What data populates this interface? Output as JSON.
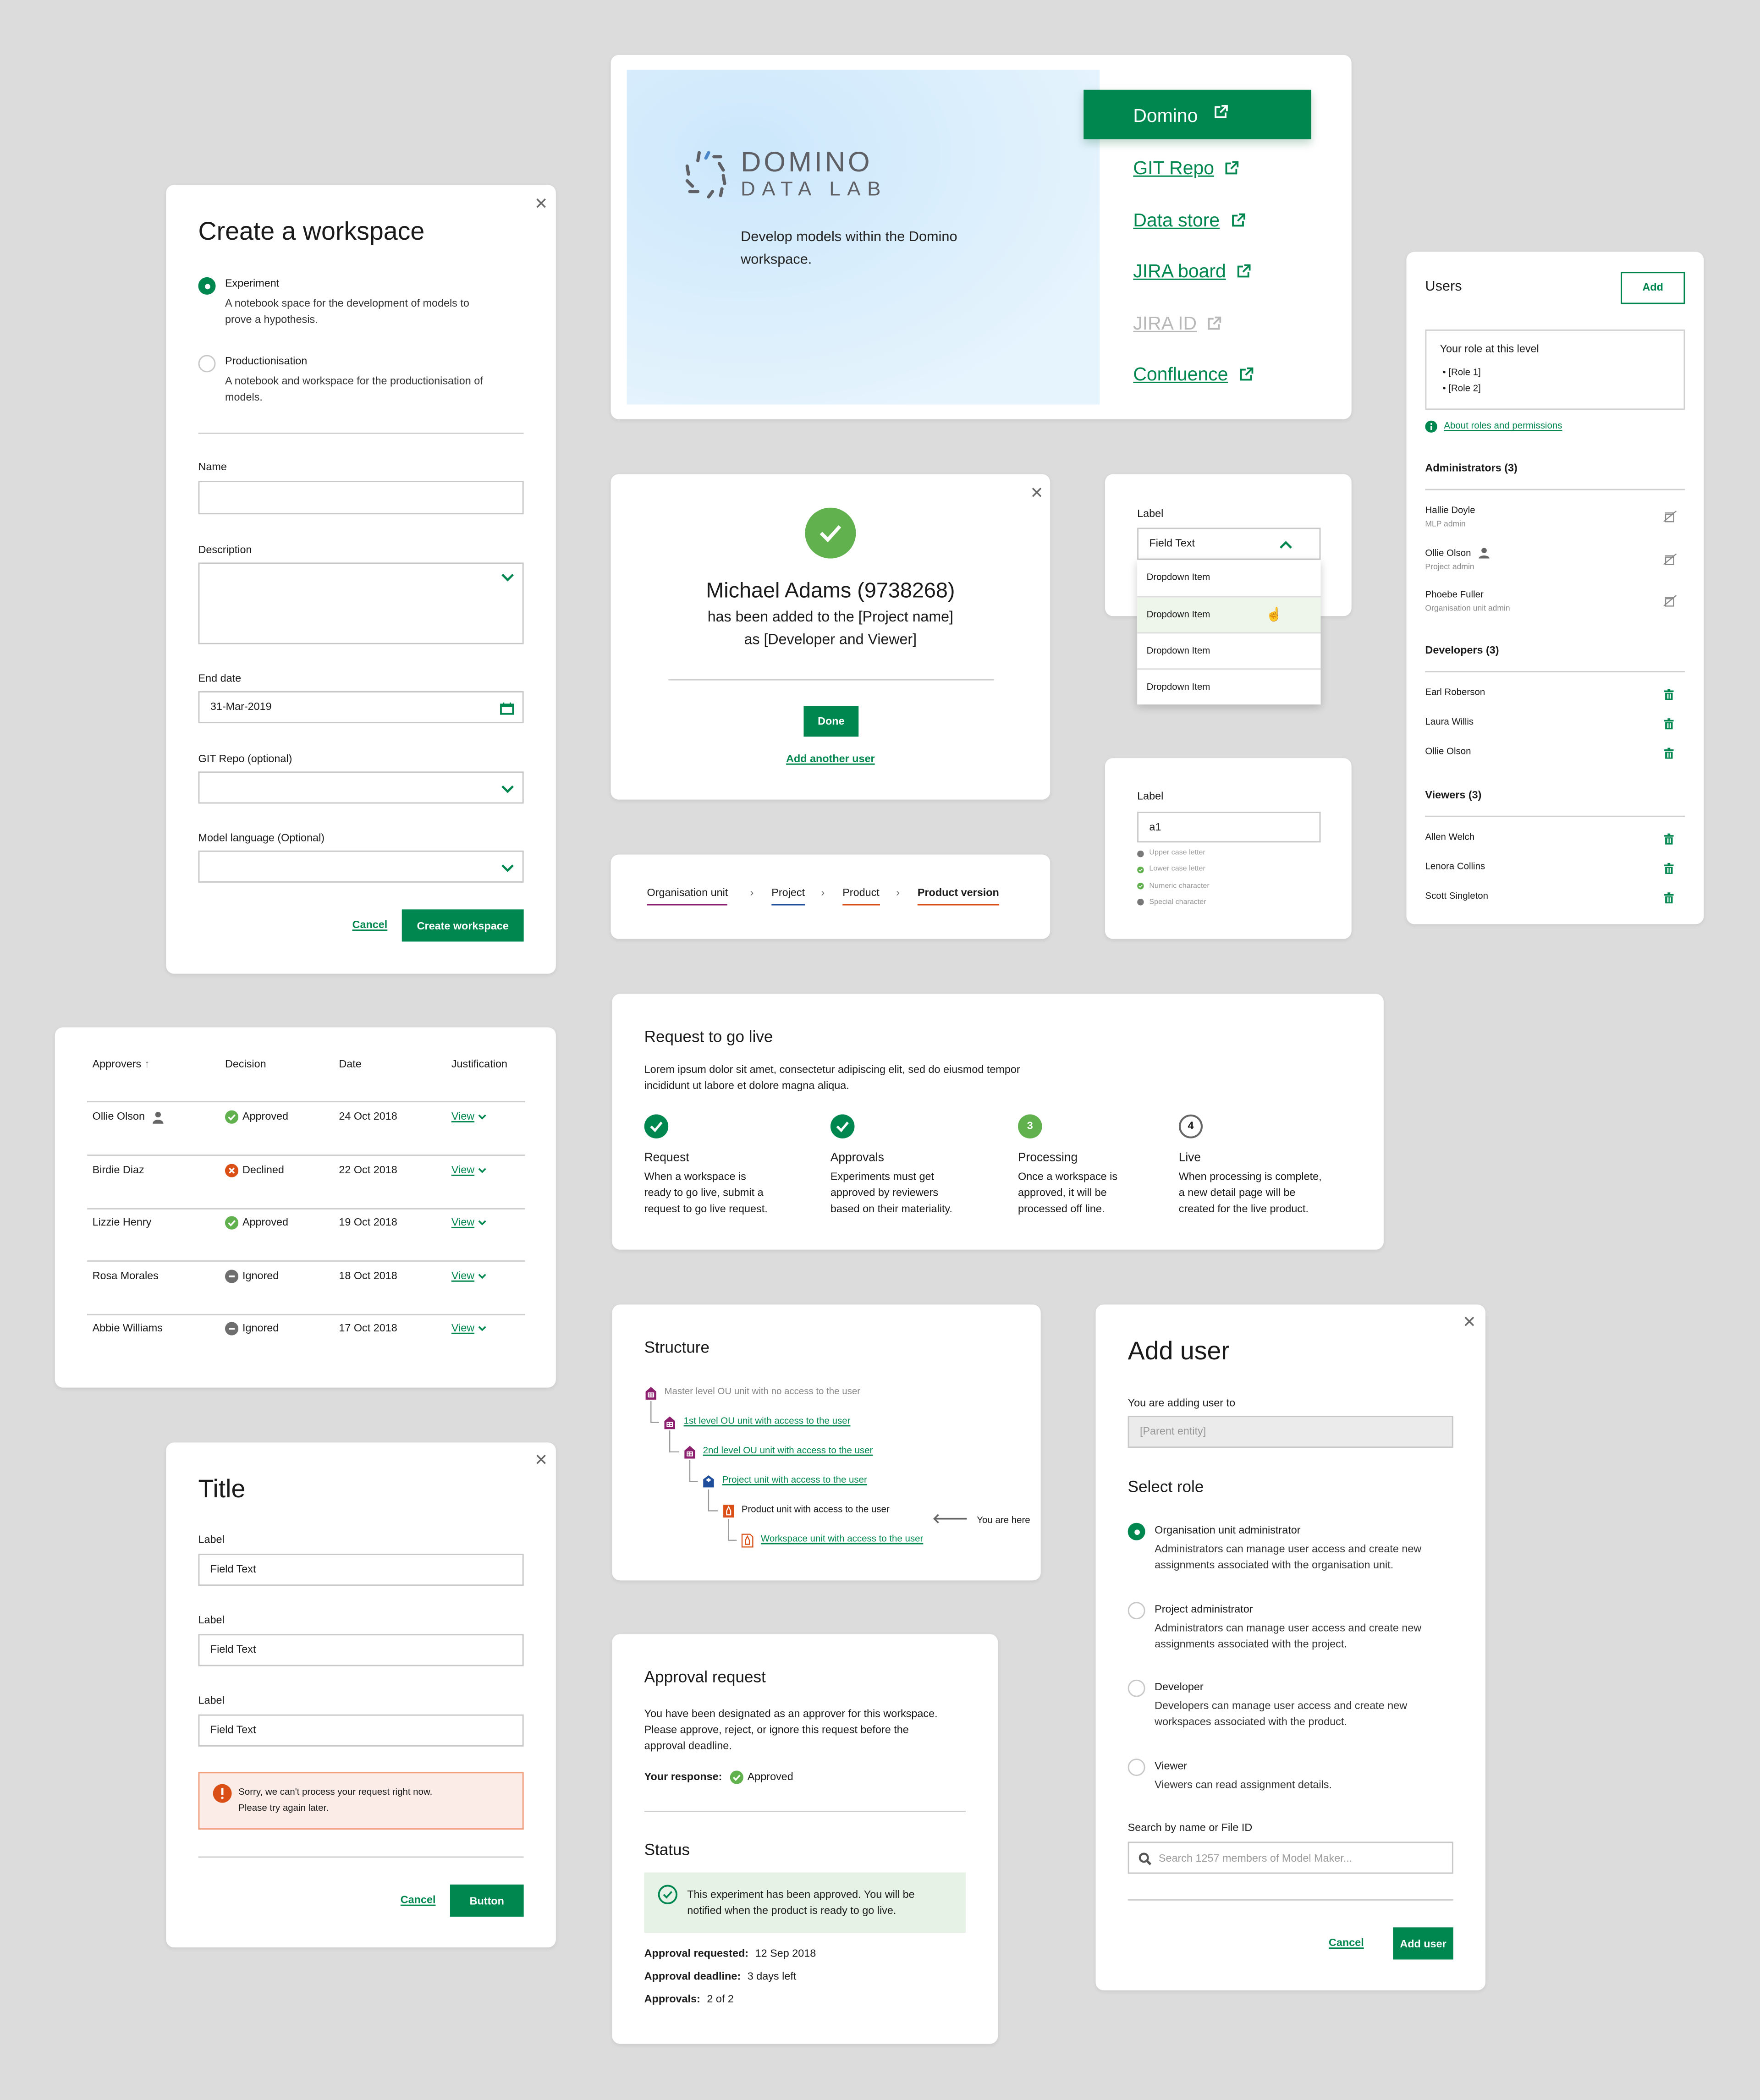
{
  "colors": {
    "primary": "#00874f",
    "success": "#62b14f",
    "error": "#d94f16",
    "ou": "#8b1f6e",
    "project": "#1f4e9c",
    "product": "#d94f16"
  },
  "create_workspace": {
    "title": "Create a workspace",
    "types": [
      {
        "label": "Experiment",
        "desc1": "A notebook space for the development of models to",
        "desc2": "prove a hypothesis.",
        "selected": true
      },
      {
        "label": "Productionisation",
        "desc1": "A notebook and workspace for the productionisation of",
        "desc2": "models.",
        "selected": false
      }
    ],
    "name_label": "Name",
    "name_value": "",
    "description_label": "Description",
    "end_date_label": "End date",
    "end_date_value": "31-Mar-2019",
    "git_label": "GIT Repo (optional)",
    "language_label": "Model language (Optional)",
    "cancel": "Cancel",
    "submit": "Create workspace"
  },
  "domino": {
    "logo_top": "DOMINO",
    "logo_bottom": "DATA LAB",
    "description1": "Develop models within the Domino",
    "description2": "workspace.",
    "primary_link": "Domino",
    "links": [
      {
        "label": "GIT Repo",
        "disabled": false
      },
      {
        "label": "Data store",
        "disabled": false
      },
      {
        "label": "JIRA board",
        "disabled": false
      },
      {
        "label": "JIRA ID",
        "disabled": true
      },
      {
        "label": "Confluence",
        "disabled": false
      }
    ]
  },
  "users": {
    "title": "Users",
    "add": "Add",
    "role_title": "Your role at this level",
    "roles": [
      "[Role 1]",
      "[Role 2]"
    ],
    "about_link": "About roles and permissions",
    "groups": [
      {
        "title": "Administrators (3)",
        "members": [
          {
            "name": "Hallie Doyle",
            "role": "MLP admin",
            "current": false,
            "removable": false
          },
          {
            "name": "Ollie Olson",
            "role": "Project admin",
            "current": true,
            "removable": false
          },
          {
            "name": "Phoebe Fuller",
            "role": "Organisation unit admin",
            "current": false,
            "removable": false
          }
        ]
      },
      {
        "title": "Developers (3)",
        "members": [
          {
            "name": "Earl Roberson",
            "removable": true
          },
          {
            "name": "Laura Willis",
            "removable": true
          },
          {
            "name": "Ollie Olson",
            "removable": true
          }
        ]
      },
      {
        "title": "Viewers (3)",
        "members": [
          {
            "name": "Allen Welch",
            "removable": true
          },
          {
            "name": "Lenora Collins",
            "removable": true
          },
          {
            "name": "Scott Singleton",
            "removable": true
          }
        ]
      }
    ]
  },
  "success": {
    "name": "Michael Adams (9738268)",
    "line2": "has been added to the [Project name]",
    "line3": "as [Developer and Viewer]",
    "done": "Done",
    "add_another": "Add another user"
  },
  "dropdown": {
    "label": "Label",
    "value": "Field Text",
    "items": [
      "Dropdown Item",
      "Dropdown Item",
      "Dropdown Item",
      "Dropdown Item"
    ],
    "hovered_index": 1
  },
  "password": {
    "label": "Label",
    "value": "a1",
    "criteria": [
      {
        "text": "Upper case letter",
        "met": false
      },
      {
        "text": "Lower case letter",
        "met": true
      },
      {
        "text": "Numeric character",
        "met": true
      },
      {
        "text": "Special character",
        "met": false
      }
    ]
  },
  "breadcrumb": [
    {
      "label": "Organisation unit",
      "color": "#8b1f6e"
    },
    {
      "label": "Project",
      "color": "#1f4e9c"
    },
    {
      "label": "Product",
      "color": "#d94f16"
    },
    {
      "label": "Product version",
      "color": "#d94f16"
    }
  ],
  "approvers": {
    "headers": [
      "Approvers",
      "Decision",
      "Date",
      "Justification"
    ],
    "rows": [
      {
        "name": "Ollie Olson",
        "current": true,
        "decision": "Approved",
        "date": "24 Oct 2018",
        "link": "View"
      },
      {
        "name": "Birdie Diaz",
        "current": false,
        "decision": "Declined",
        "date": "22 Oct 2018",
        "link": "View"
      },
      {
        "name": "Lizzie Henry",
        "current": false,
        "decision": "Approved",
        "date": "19 Oct 2018",
        "link": "View"
      },
      {
        "name": "Rosa Morales",
        "current": false,
        "decision": "Ignored",
        "date": "18 Oct 2018",
        "link": "View"
      },
      {
        "name": "Abbie Williams",
        "current": false,
        "decision": "Ignored",
        "date": "17 Oct 2018",
        "link": "View"
      }
    ]
  },
  "go_live": {
    "title": "Request to go live",
    "intro1": "Lorem ipsum dolor sit amet, consectetur adipiscing elit, sed do eiusmod tempor",
    "intro2": "incididunt ut labore et dolore magna aliqua.",
    "steps": [
      {
        "marker": "",
        "state": "done",
        "title": "Request",
        "lines": [
          "When a workspace is",
          "ready to go live, submit a",
          "request to go live request."
        ]
      },
      {
        "marker": "",
        "state": "done",
        "title": "Approvals",
        "lines": [
          "Experiments must get",
          "approved by reviewers",
          "based on their materiality."
        ]
      },
      {
        "marker": "3",
        "state": "current",
        "title": "Processing",
        "lines": [
          "Once a workspace is",
          "approved, it will be",
          "processed off line."
        ]
      },
      {
        "marker": "4",
        "state": "todo",
        "title": "Live",
        "lines": [
          "When processing is complete,",
          "a new detail page will be",
          "created for the live product."
        ]
      }
    ]
  },
  "title_form": {
    "title": "Title",
    "fields": [
      {
        "label": "Label",
        "value": "Field Text"
      },
      {
        "label": "Label",
        "value": "Field Text"
      },
      {
        "label": "Label",
        "value": "Field Text"
      }
    ],
    "error1": "Sorry, we can't process your request right now.",
    "error2": "Please try again later.",
    "cancel": "Cancel",
    "submit": "Button"
  },
  "structure": {
    "title": "Structure",
    "nodes": [
      {
        "label": "Master level OU unit with no access to the user",
        "type": "ou",
        "link": false
      },
      {
        "label": "1st level OU unit with access to the user",
        "type": "ou",
        "link": true
      },
      {
        "label": "2nd level OU unit with access to the user",
        "type": "ou",
        "link": true
      },
      {
        "label": "Project unit with access to the user",
        "type": "project",
        "link": true
      },
      {
        "label": "Product unit with access to the user",
        "type": "product",
        "link": false
      },
      {
        "label": "Workspace unit with access to the user",
        "type": "workspace",
        "link": true
      }
    ],
    "you_are_here": "You are here"
  },
  "approval": {
    "title": "Approval request",
    "para": [
      "You have been designated as an approver for this workspace.",
      "Please approve, reject, or ignore this request before the",
      "approval deadline."
    ],
    "response_label": "Your response:",
    "response_value": "Approved",
    "status_title": "Status",
    "status1": "This experiment has been approved. You will be",
    "status2": "notified when the product is ready to go live.",
    "meta": [
      {
        "label": "Approval requested:",
        "value": "12 Sep 2018"
      },
      {
        "label": "Approval deadline:",
        "value": "3 days left"
      },
      {
        "label": "Approvals:",
        "value": "2 of 2"
      }
    ]
  },
  "add_user": {
    "title": "Add user",
    "target_label": "You are adding user to",
    "target_placeholder": "[Parent entity]",
    "role_title": "Select role",
    "roles": [
      {
        "label": "Organisation unit administrator",
        "d1": "Administrators can manage user access and create new",
        "d2": "assignments associated with the organisation unit.",
        "selected": true
      },
      {
        "label": "Project administrator",
        "d1": "Administrators can manage user access and create new",
        "d2": "assignments associated with the project.",
        "selected": false
      },
      {
        "label": "Developer",
        "d1": "Developers can manage user access and create new",
        "d2": "workspaces associated with the product.",
        "selected": false
      },
      {
        "label": "Viewer",
        "d1": "Viewers can read assignment details.",
        "d2": "",
        "selected": false
      }
    ],
    "search_label": "Search by name or File ID",
    "search_placeholder": "Search 1257 members of Model Maker...",
    "cancel": "Cancel",
    "submit": "Add user"
  }
}
